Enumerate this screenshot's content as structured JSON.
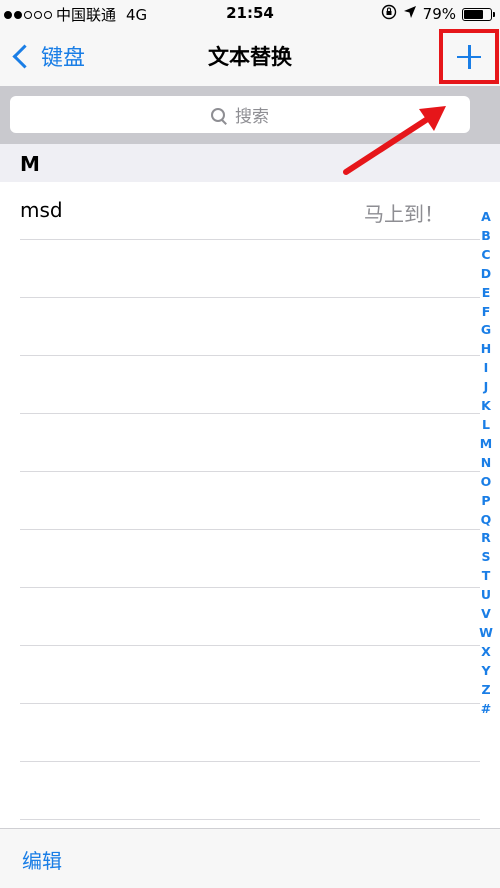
{
  "status_bar": {
    "carrier": "中国联通",
    "network": "4G",
    "time": "21:54",
    "battery": "79%",
    "battery_level": 0.79,
    "signal_bars": 2
  },
  "nav": {
    "back_label": "键盘",
    "title": "文本替换",
    "add_icon": "plus-icon"
  },
  "search": {
    "placeholder": "搜索"
  },
  "section": {
    "header": "M"
  },
  "rows": [
    {
      "phrase": "msd",
      "shortcut": "马上到！"
    }
  ],
  "index_letters": [
    "A",
    "B",
    "C",
    "D",
    "E",
    "F",
    "G",
    "H",
    "I",
    "J",
    "K",
    "L",
    "M",
    "N",
    "O",
    "P",
    "Q",
    "R",
    "S",
    "T",
    "U",
    "V",
    "W",
    "X",
    "Y",
    "Z",
    "#"
  ],
  "toolbar": {
    "edit_label": "编辑"
  },
  "colors": {
    "accent": "#1a7ee6",
    "highlight": "#e6161a"
  }
}
